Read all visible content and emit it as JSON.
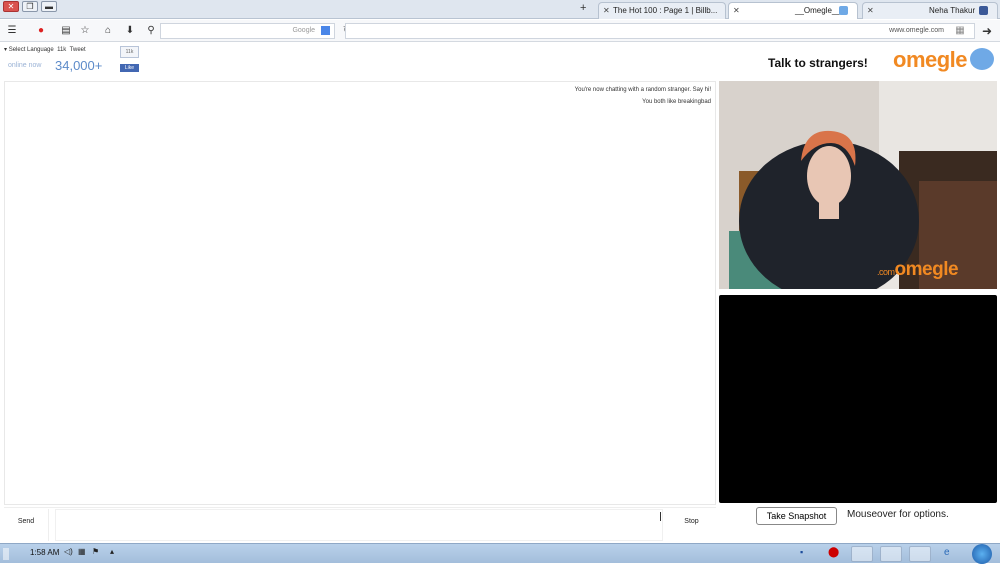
{
  "tabs": [
    {
      "label": "Neha Thakur",
      "icon": "facebook-icon",
      "active": false
    },
    {
      "label": "__Omegle__",
      "icon": "omegle-icon",
      "active": true
    },
    {
      "label": "The Hot 100 : Page 1 | Billb...",
      "icon": "billboard-icon",
      "active": false
    }
  ],
  "url": "www.omegle.com",
  "search_placeholder": "Google",
  "header": {
    "logo": "omegle",
    "tagline": "Talk to strangers!",
    "online_count": "34,000+",
    "online_label": "online now",
    "language": "Select Language",
    "tweet": "Tweet",
    "like": "Like",
    "like_count": "11k"
  },
  "chat": {
    "lines": [
      "You're now chatting with a random stranger. Say hi!",
      "You both like breakingbad"
    ]
  },
  "input": {
    "send_label": "Send",
    "stop_label": "Stop"
  },
  "video": {
    "watermark": "omegle",
    "watermark_suffix": ".com",
    "snapshot_label": "Take Snapshot",
    "mouseover_label": "Mouseover for options."
  },
  "taskbar": {
    "time": "1:58 AM"
  },
  "colors": {
    "omegle_orange": "#f18922",
    "omegle_blue": "#6fa9e6",
    "taskbar": "#b9d1ea"
  }
}
